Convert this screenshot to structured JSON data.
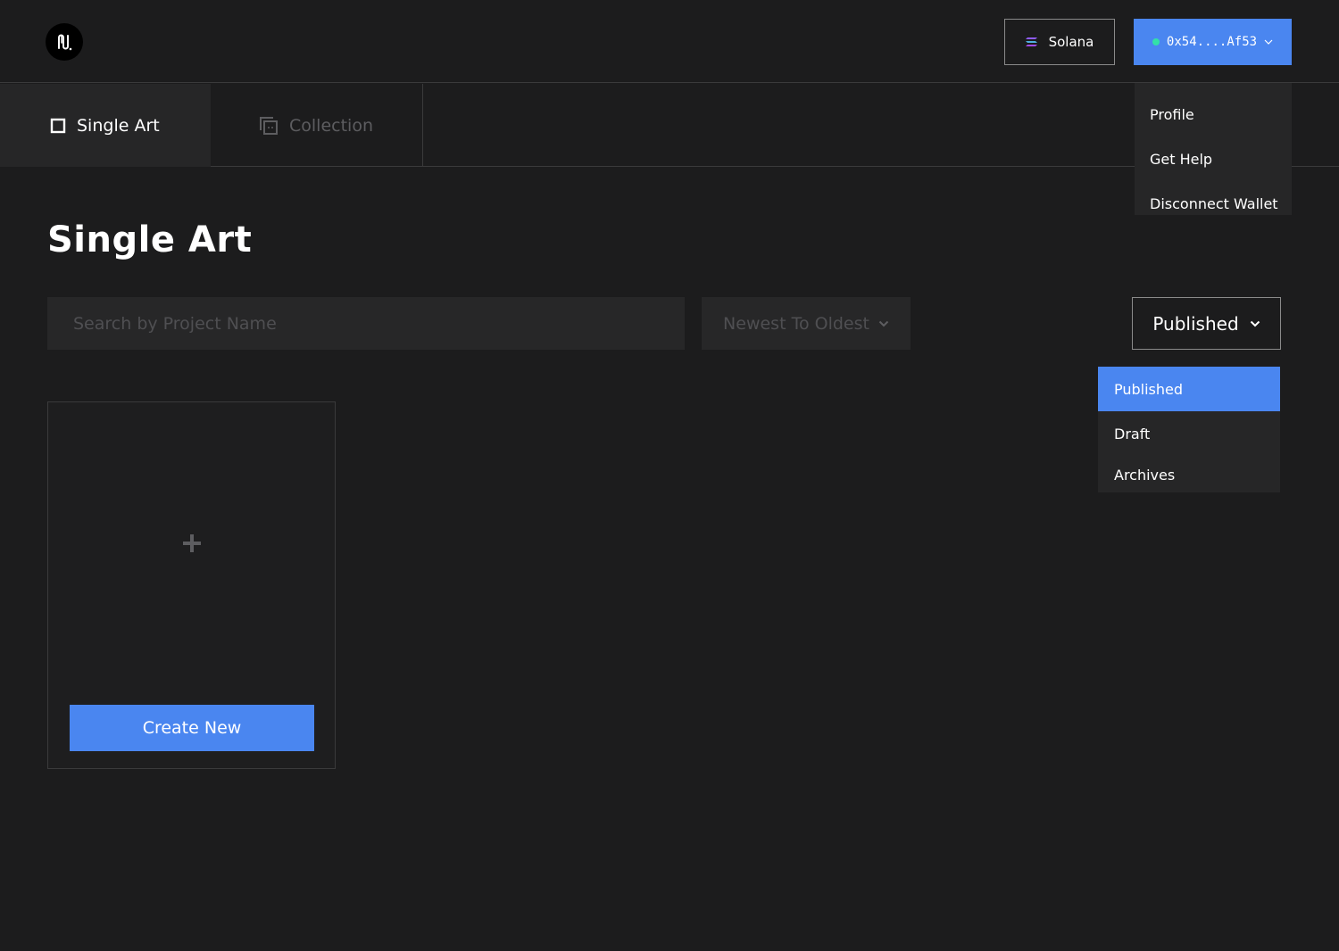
{
  "header": {
    "logo_name": "brand-logo",
    "network_label": "Solana",
    "wallet_address": "0x54....Af53"
  },
  "user_menu": {
    "items": [
      "Profile",
      "Get Help",
      "Disconnect Wallet"
    ]
  },
  "tabs": [
    {
      "label": "Single Art",
      "active": true
    },
    {
      "label": "Collection",
      "active": false
    }
  ],
  "page": {
    "title": "Single Art"
  },
  "filters": {
    "search_placeholder": "Search by Project Name",
    "sort_label": "Newest To Oldest",
    "status_label": "Published"
  },
  "status_menu": {
    "options": [
      {
        "label": "Published",
        "selected": true
      },
      {
        "label": "Draft",
        "selected": false
      },
      {
        "label": "Archives",
        "selected": false
      }
    ]
  },
  "create_card": {
    "button_label": "Create New"
  },
  "colors": {
    "background": "#1c1c1d",
    "accent": "#4a86f0",
    "wallet_status": "#33e0a8",
    "muted_text": "#5d5d60"
  }
}
